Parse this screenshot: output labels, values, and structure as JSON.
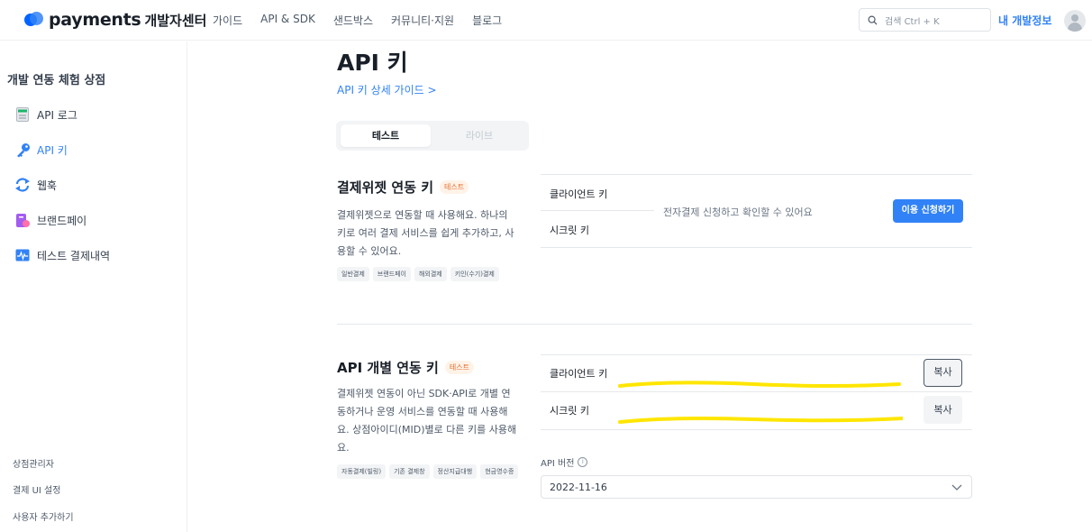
{
  "brand": {
    "name": "payments",
    "sub": "개발자센터"
  },
  "nav": [
    "가이드",
    "API & SDK",
    "샌드박스",
    "커뮤니티·지원",
    "블로그"
  ],
  "search": {
    "placeholder": "검색 Ctrl + K"
  },
  "my_info": "내 개발정보",
  "sidebar": {
    "shop_name": "개발 연동 체험 상점",
    "items": [
      {
        "label": "API 로그",
        "icon": "log-icon"
      },
      {
        "label": "API 키",
        "icon": "key-icon",
        "active": true
      },
      {
        "label": "웹훅",
        "icon": "webhook-icon"
      },
      {
        "label": "브랜드페이",
        "icon": "brandpay-icon"
      },
      {
        "label": "테스트 결제내역",
        "icon": "payment-history-icon"
      }
    ],
    "bottom": [
      "상점관리자",
      "결제 UI 설정",
      "사용자 추가하기"
    ]
  },
  "main": {
    "title": "API 키",
    "guide_link": "API 키 상세 가이드 >",
    "env_tabs": {
      "test": "테스트",
      "live": "라이브",
      "selected": "테스트"
    },
    "widget_section": {
      "title": "결제위젯 연동 키",
      "badge": "테스트",
      "description": "결제위젯으로 연동할 때 사용해요. 하나의 키로 여러 결제 서비스를 쉽게 추가하고, 사용할 수 있어요.",
      "chips": [
        "일반결제",
        "브랜드페이",
        "해외결제",
        "키인(수기)결제"
      ],
      "client_key_label": "클라이언트 키",
      "secret_key_label": "시크릿 키",
      "note": "전자결제 신청하고 확인할 수 있어요",
      "apply_button": "이용 신청하기"
    },
    "individual_section": {
      "title": "API 개별 연동 키",
      "badge": "테스트",
      "description": "결제위젯 연동이 아닌 SDK·API로 개별 연동하거나 운영 서비스를 연동할 때 사용해요. 상점아이디(MID)별로 다른 키를 사용해요.",
      "chips": [
        "자동결제(빌링)",
        "기존 결제창",
        "정산지급대행",
        "현금영수증"
      ],
      "client_key_label": "클라이언트 키",
      "secret_key_label": "시크릿 키",
      "copy_label": "복사",
      "api_version_label": "API 버전",
      "api_version_value": "2022-11-16"
    }
  },
  "colors": {
    "accent": "#3182f6",
    "badge": "#e5692a",
    "redaction": "#ffe600"
  }
}
